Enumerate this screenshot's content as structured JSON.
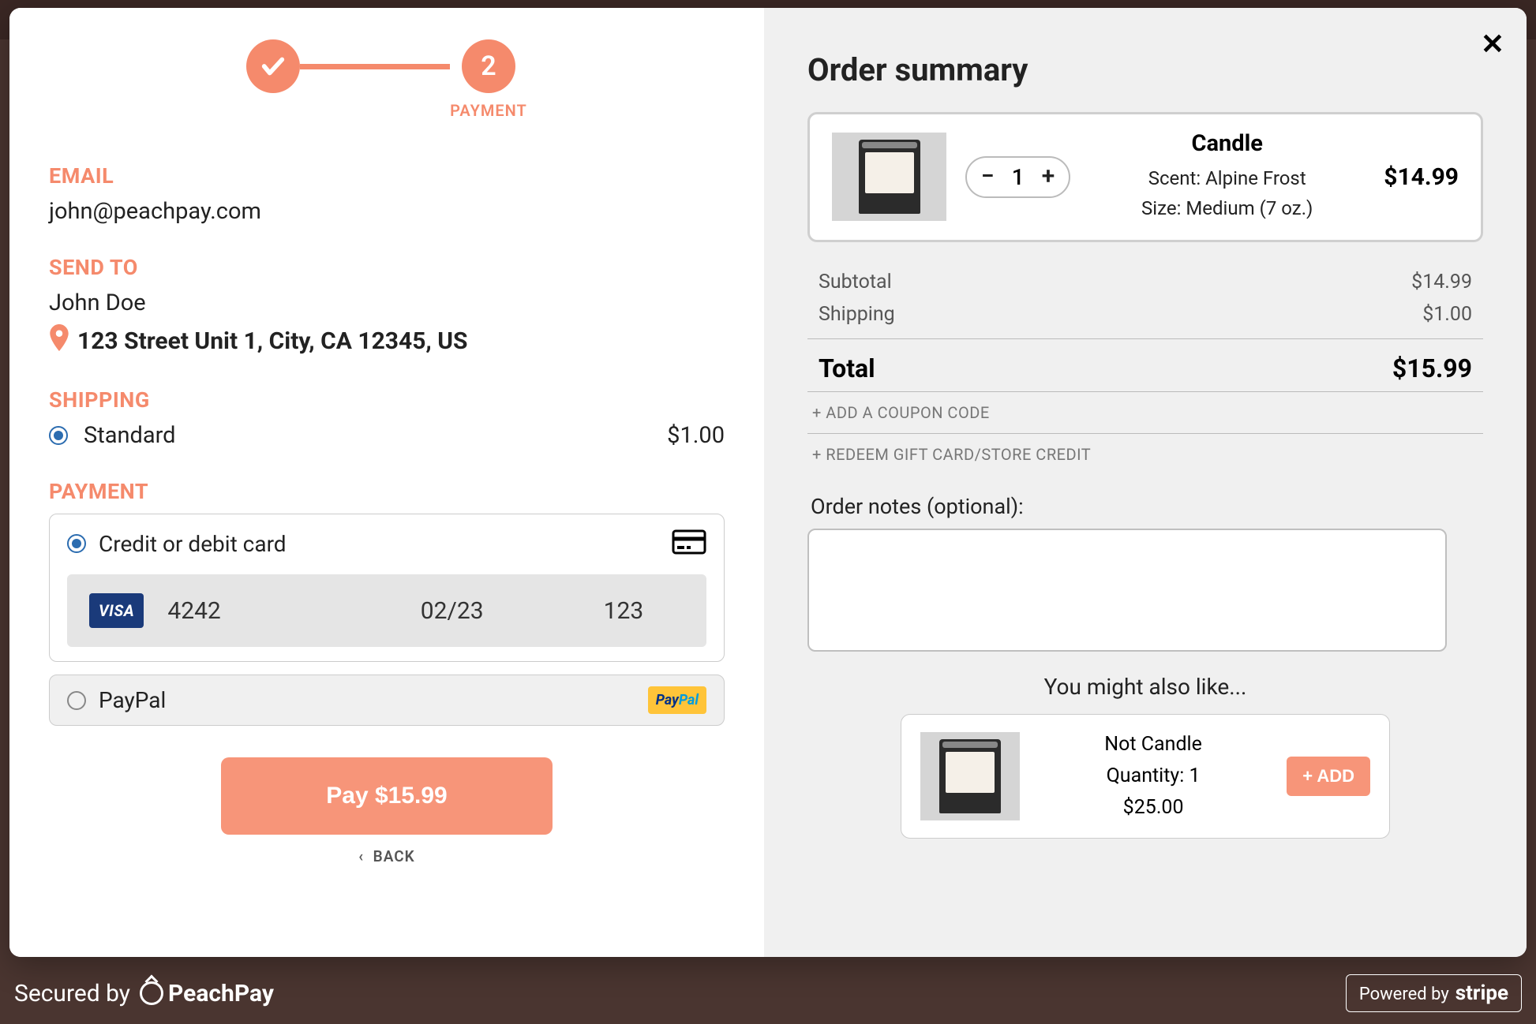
{
  "stepper": {
    "step2_number": "2",
    "step2_label": "PAYMENT"
  },
  "email": {
    "label": "EMAIL",
    "value": "john@peachpay.com"
  },
  "send_to": {
    "label": "SEND TO",
    "name": "John Doe",
    "address": "123 Street Unit 1, City, CA 12345, US"
  },
  "shipping": {
    "label": "SHIPPING",
    "option_name": "Standard",
    "option_price": "$1.00"
  },
  "payment": {
    "label": "PAYMENT",
    "card_option": "Credit or debit card",
    "card_brand": "VISA",
    "card_number": "4242",
    "card_exp": "02/23",
    "card_cvc": "123",
    "paypal_option": "PayPal",
    "paypal_pay": "Pay",
    "paypal_pal": "Pal"
  },
  "pay_button": "Pay $15.99",
  "back": "BACK",
  "summary": {
    "title": "Order summary",
    "item": {
      "name": "Candle",
      "scent": "Scent: Alpine Frost",
      "size": "Size: Medium (7 oz.)",
      "price": "$14.99",
      "qty": "1"
    },
    "subtotal_label": "Subtotal",
    "subtotal_value": "$14.99",
    "shipping_label": "Shipping",
    "shipping_value": "$1.00",
    "total_label": "Total",
    "total_value": "$15.99",
    "coupon_link": "+ ADD A COUPON CODE",
    "giftcard_link": "+ REDEEM GIFT CARD/STORE CREDIT",
    "notes_label": "Order notes (optional):"
  },
  "upsell": {
    "title": "You might also like...",
    "name": "Not Candle",
    "qty": "Quantity: 1",
    "price": "$25.00",
    "add": "+ ADD"
  },
  "footer": {
    "secured": "Secured by",
    "brand": "PeachPay",
    "stripe_prefix": "Powered by",
    "stripe": "stripe"
  }
}
